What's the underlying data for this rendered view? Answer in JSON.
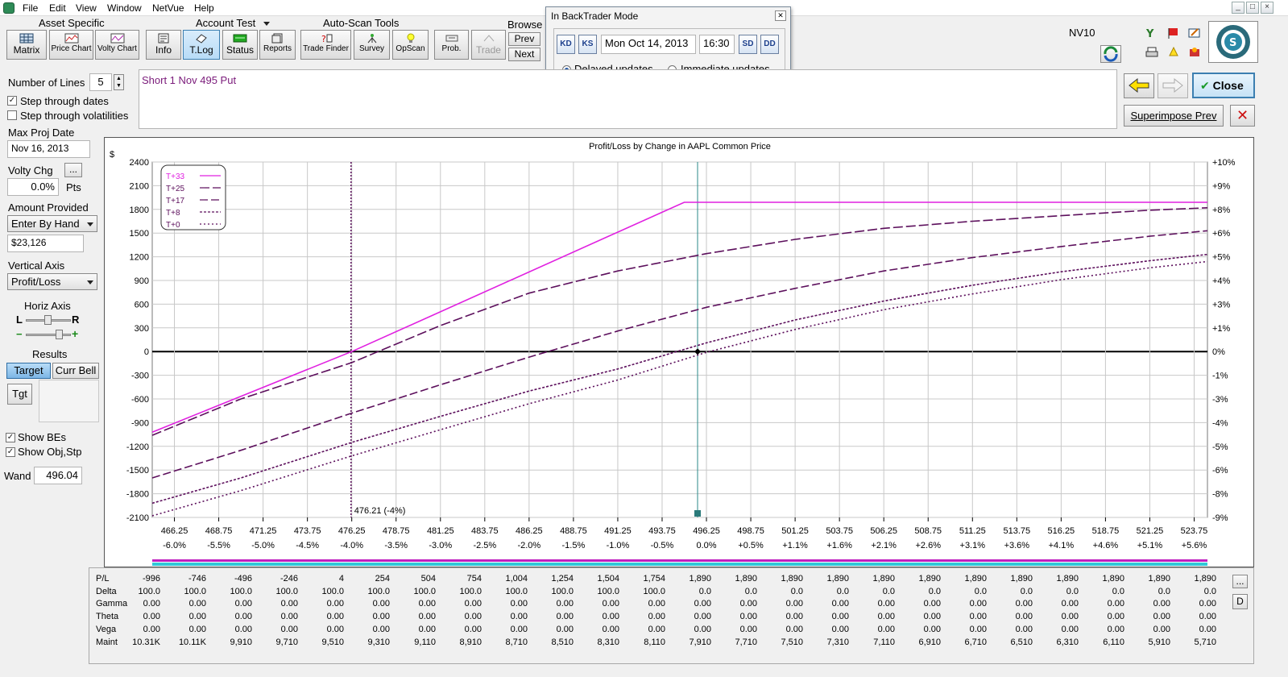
{
  "menu": [
    "File",
    "Edit",
    "View",
    "Window",
    "NetVue",
    "Help"
  ],
  "window_controls": [
    "_",
    "□",
    "×"
  ],
  "toolbar": {
    "groups": {
      "asset": "Asset Specific",
      "account": "Account Test",
      "autoscan": "Auto-Scan Tools",
      "browse": "Browse"
    },
    "buttons": {
      "matrix": "Matrix",
      "price_chart": "Price Chart",
      "volty_chart": "Volty Chart",
      "info": "Info",
      "tlog": "T.Log",
      "status": "Status",
      "reports": "Reports",
      "trade_finder": "Trade Finder",
      "survey": "Survey",
      "opscan": "OpScan",
      "prob": "Prob.",
      "trade": "Trade",
      "prev": "Prev",
      "next": "Next"
    },
    "account_name": "NV10"
  },
  "backtrader": {
    "title": "In BackTrader Mode",
    "nav": [
      "KD",
      "KS",
      "SD",
      "DD"
    ],
    "date": "Mon Oct 14, 2013",
    "time": "16:30",
    "delayed": "Delayed updates",
    "immediate": "Immediate updates"
  },
  "right_controls": {
    "close": "Close",
    "superimpose": "Superimpose Prev",
    "x_label": "✕"
  },
  "position_text": "Short 1 Nov 495 Put",
  "left_panel": {
    "num_lines_label": "Number of Lines",
    "num_lines": "5",
    "step_dates": "Step through dates",
    "step_vols": "Step through volatilities",
    "max_proj_label": "Max Proj Date",
    "max_proj": "Nov 16, 2013",
    "volty_chg_label": "Volty Chg",
    "volty_chg_btn": "...",
    "volty_chg_value": "0.0%",
    "volty_unit": "Pts",
    "amount_label": "Amount Provided",
    "amount_mode": "Enter By Hand",
    "amount_value": "$23,126",
    "vaxis_label": "Vertical Axis",
    "vaxis_value": "Profit/Loss",
    "haxis_label": "Horiz Axis",
    "haxis_l": "L",
    "haxis_r": "R",
    "haxis_minus": "−",
    "haxis_plus": "+",
    "results_label": "Results",
    "target": "Target",
    "curr_bell": "Curr Bell",
    "tgt": "Tgt",
    "show_bes": "Show BEs",
    "show_obj": "Show Obj,Stp",
    "wand_label": "Wand",
    "wand_value": "496.04"
  },
  "chart_data": {
    "type": "line",
    "title": "Profit/Loss by Change in AAPL Common Price",
    "ylabel": "$",
    "ylim": [
      -2100,
      2400
    ],
    "yticks": [
      2400,
      2100,
      1800,
      1500,
      1200,
      900,
      600,
      300,
      0,
      -300,
      -600,
      -900,
      -1200,
      -1500,
      -1800,
      -2100
    ],
    "right_ticks": [
      "+10%",
      "+9%",
      "+8%",
      "+6%",
      "+5%",
      "+4%",
      "+3%",
      "+1%",
      "0%",
      "-1%",
      "-3%",
      "-4%",
      "-5%",
      "-6%",
      "-8%",
      "-9%"
    ],
    "x_ticks": [
      "466.25",
      "468.75",
      "471.25",
      "473.75",
      "476.25",
      "478.75",
      "481.25",
      "483.75",
      "486.25",
      "488.75",
      "491.25",
      "493.75",
      "496.25",
      "498.75",
      "501.25",
      "503.75",
      "506.25",
      "508.75",
      "511.25",
      "513.75",
      "516.25",
      "518.75",
      "521.25",
      "523.75"
    ],
    "x_pct": [
      "-6.0%",
      "-5.5%",
      "-5.0%",
      "-4.5%",
      "-4.0%",
      "-3.5%",
      "-3.0%",
      "-2.5%",
      "-2.0%",
      "-1.5%",
      "-1.0%",
      "-0.5%",
      "0.0%",
      "+0.5%",
      "+1.1%",
      "+1.6%",
      "+2.1%",
      "+2.6%",
      "+3.1%",
      "+3.6%",
      "+4.1%",
      "+4.6%",
      "+5.1%",
      "+5.6%"
    ],
    "xlim": [
      465.0,
      524.5
    ],
    "breakeven": 476.21,
    "breakeven_label": "476.21 (-4%)",
    "current_price": 495.75,
    "legend": [
      "T+33",
      "T+25",
      "T+17",
      "T+8",
      "T+0"
    ],
    "series": [
      {
        "name": "T+33",
        "color": "#e020e0",
        "dash": "",
        "x": [
          465.0,
          476.25,
          495.0,
          524.5
        ],
        "y": [
          -1020,
          0,
          1890,
          1890
        ]
      },
      {
        "name": "T+25",
        "color": "#5c0f5c",
        "dash": "12,4",
        "x": [
          465.0,
          470,
          476.25,
          481.25,
          486.25,
          491.25,
          496.25,
          501.25,
          506.25,
          511.25,
          516.25,
          521.25,
          524.5
        ],
        "y": [
          -1060,
          -600,
          -140,
          330,
          740,
          1020,
          1240,
          1420,
          1560,
          1650,
          1720,
          1790,
          1820
        ]
      },
      {
        "name": "T+17",
        "color": "#5c0f5c",
        "dash": "10,4",
        "x": [
          465.0,
          470,
          476.25,
          481.25,
          486.25,
          491.25,
          496.25,
          501.25,
          506.25,
          511.25,
          516.25,
          521.25,
          524.5
        ],
        "y": [
          -1600,
          -1250,
          -780,
          -420,
          -70,
          260,
          560,
          800,
          1020,
          1190,
          1330,
          1460,
          1530
        ]
      },
      {
        "name": "T+8",
        "color": "#5c0f5c",
        "dash": "3,2",
        "x": [
          465.0,
          470,
          476.25,
          481.25,
          486.25,
          491.25,
          496.25,
          501.25,
          506.25,
          511.25,
          516.25,
          521.25,
          524.5
        ],
        "y": [
          -1920,
          -1600,
          -1150,
          -820,
          -500,
          -220,
          110,
          400,
          640,
          840,
          1010,
          1150,
          1230
        ]
      },
      {
        "name": "T+0",
        "color": "#5c0f5c",
        "dash": "2,3",
        "x": [
          465.0,
          470,
          476.25,
          481.25,
          486.25,
          491.25,
          496.25,
          501.25,
          506.25,
          511.25,
          516.25,
          521.25,
          524.5
        ],
        "y": [
          -2080,
          -1760,
          -1320,
          -990,
          -660,
          -360,
          -10,
          280,
          530,
          730,
          910,
          1060,
          1140
        ]
      }
    ]
  },
  "results_table": {
    "rows": [
      {
        "label": "P/L",
        "values": [
          "-996",
          "-746",
          "-496",
          "-246",
          "4",
          "254",
          "504",
          "754",
          "1,004",
          "1,254",
          "1,504",
          "1,754",
          "1,890",
          "1,890",
          "1,890",
          "1,890",
          "1,890",
          "1,890",
          "1,890",
          "1,890",
          "1,890",
          "1,890",
          "1,890",
          "1,890"
        ]
      },
      {
        "label": "Delta",
        "values": [
          "100.0",
          "100.0",
          "100.0",
          "100.0",
          "100.0",
          "100.0",
          "100.0",
          "100.0",
          "100.0",
          "100.0",
          "100.0",
          "100.0",
          "0.0",
          "0.0",
          "0.0",
          "0.0",
          "0.0",
          "0.0",
          "0.0",
          "0.0",
          "0.0",
          "0.0",
          "0.0",
          "0.0"
        ]
      },
      {
        "label": "Gamma",
        "values": [
          "0.00",
          "0.00",
          "0.00",
          "0.00",
          "0.00",
          "0.00",
          "0.00",
          "0.00",
          "0.00",
          "0.00",
          "0.00",
          "0.00",
          "0.00",
          "0.00",
          "0.00",
          "0.00",
          "0.00",
          "0.00",
          "0.00",
          "0.00",
          "0.00",
          "0.00",
          "0.00",
          "0.00"
        ]
      },
      {
        "label": "Theta",
        "values": [
          "0.00",
          "0.00",
          "0.00",
          "0.00",
          "0.00",
          "0.00",
          "0.00",
          "0.00",
          "0.00",
          "0.00",
          "0.00",
          "0.00",
          "0.00",
          "0.00",
          "0.00",
          "0.00",
          "0.00",
          "0.00",
          "0.00",
          "0.00",
          "0.00",
          "0.00",
          "0.00",
          "0.00"
        ]
      },
      {
        "label": "Vega",
        "values": [
          "0.00",
          "0.00",
          "0.00",
          "0.00",
          "0.00",
          "0.00",
          "0.00",
          "0.00",
          "0.00",
          "0.00",
          "0.00",
          "0.00",
          "0.00",
          "0.00",
          "0.00",
          "0.00",
          "0.00",
          "0.00",
          "0.00",
          "0.00",
          "0.00",
          "0.00",
          "0.00",
          "0.00"
        ]
      },
      {
        "label": "Maint",
        "values": [
          "10.31K",
          "10.11K",
          "9,910",
          "9,710",
          "9,510",
          "9,310",
          "9,110",
          "8,910",
          "8,710",
          "8,510",
          "8,310",
          "8,110",
          "7,910",
          "7,710",
          "7,510",
          "7,310",
          "7,110",
          "6,910",
          "6,710",
          "6,510",
          "6,310",
          "6,110",
          "5,910",
          "5,710"
        ]
      }
    ],
    "side_buttons": [
      "...",
      "D"
    ]
  },
  "colors": {
    "accent": "#e020e0",
    "deep": "#5c0f5c",
    "teal": "#2a8a8a"
  }
}
